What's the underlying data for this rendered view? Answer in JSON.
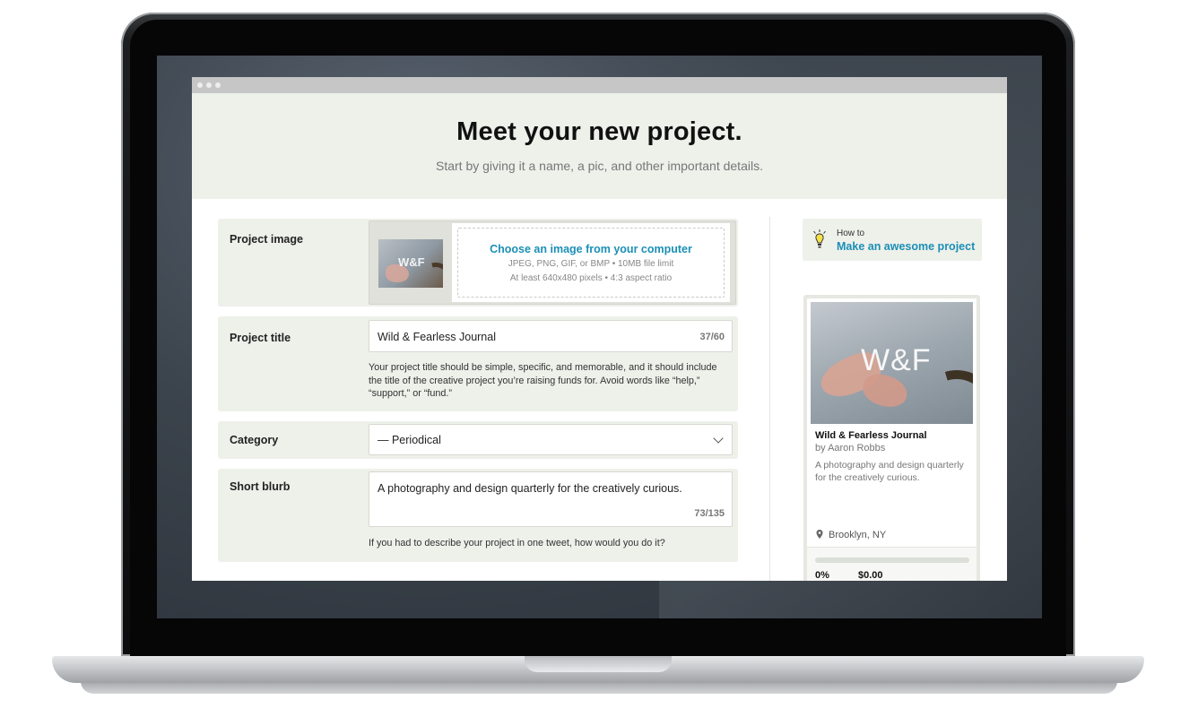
{
  "hero": {
    "title": "Meet your new project.",
    "subtitle": "Start by giving it a name, a pic, and other important details."
  },
  "form": {
    "image": {
      "label": "Project image",
      "thumb_text": "W&F",
      "choose_link": "Choose an image from your computer",
      "hint_formats": "JPEG, PNG, GIF, or BMP • 10MB file limit",
      "hint_size": "At least 640x480 pixels • 4:3 aspect ratio"
    },
    "title": {
      "label": "Project title",
      "value": "Wild & Fearless Journal",
      "counter": "37/60",
      "help": "Your project title should be simple, specific, and memorable, and it should include the title of the creative project you’re raising funds for. Avoid words like “help,” “support,” or “fund.”"
    },
    "category": {
      "label": "Category",
      "value": "— Periodical"
    },
    "blurb": {
      "label": "Short blurb",
      "value": "A photography and design quarterly for the creatively curious.",
      "counter": "73/135",
      "help": "If you had to describe your project in one tweet, how would you do it?"
    }
  },
  "sidebar": {
    "howto_small": "How to",
    "howto_link": "Make an awesome project",
    "card": {
      "image_text": "W&F",
      "title": "Wild & Fearless Journal",
      "author": "by Aaron Robbs",
      "blurb": "A photography and design quarterly for the creatively curious.",
      "location": "Brooklyn, NY",
      "progress": 0,
      "percent": "0%",
      "pledged": "$0.00"
    }
  },
  "icons": {
    "bulb": "lightbulb-icon",
    "pin": "map-pin-icon",
    "chevron": "chevron-down-icon"
  },
  "colors": {
    "accent": "#1b8fb6",
    "panel": "#eef0ea",
    "progress": "#2bde73"
  }
}
